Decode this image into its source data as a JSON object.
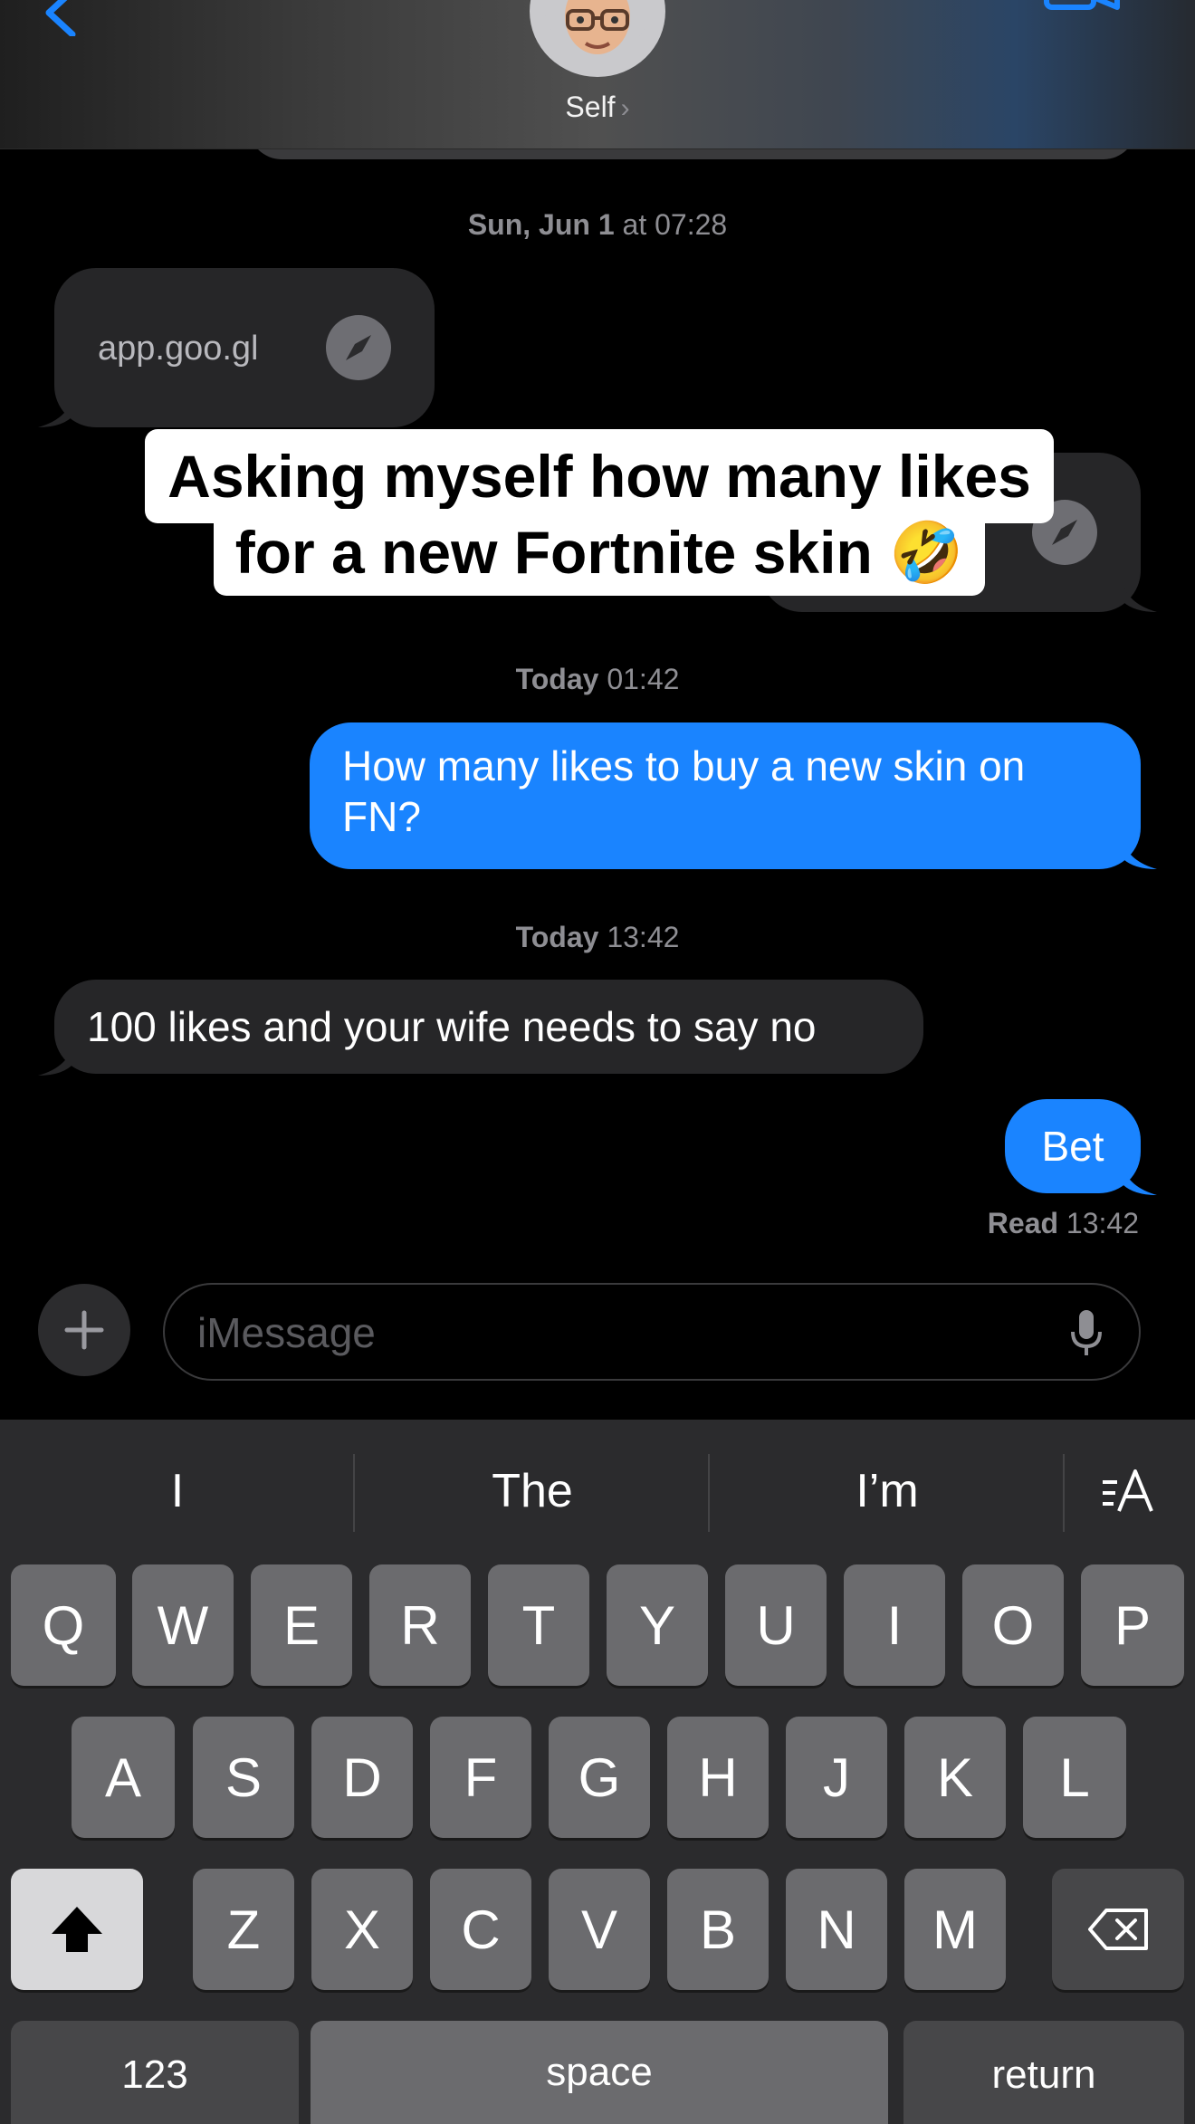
{
  "header": {
    "contact_name": "Self",
    "chevron": "›"
  },
  "messages": {
    "timestamp_1_day": "Sun, Jun 1",
    "timestamp_1_time": " at 07:28",
    "link_1_text": "app.goo.gl",
    "timestamp_2_day": "Today",
    "timestamp_2_time": " 01:42",
    "outgoing_1": "How many likes to buy a new skin on FN?",
    "timestamp_3_day": "Today",
    "timestamp_3_time": " 13:42",
    "incoming_1": "100 likes and your wife needs to say no",
    "outgoing_2": "Bet",
    "read_label": "Read",
    "read_time": " 13:42"
  },
  "caption": {
    "line_1": "Asking myself how many likes",
    "line_2": "for a new Fortnite skin 🤣"
  },
  "input": {
    "placeholder": "iMessage"
  },
  "keyboard": {
    "suggestions": [
      "I",
      "The",
      "I’m"
    ],
    "row1": [
      "Q",
      "W",
      "E",
      "R",
      "T",
      "Y",
      "U",
      "I",
      "O",
      "P"
    ],
    "row2": [
      "A",
      "S",
      "D",
      "F",
      "G",
      "H",
      "J",
      "K",
      "L"
    ],
    "row3": [
      "Z",
      "X",
      "C",
      "V",
      "B",
      "N",
      "M"
    ],
    "numbers_label": "123",
    "space_label": "space",
    "return_label": "return"
  },
  "icons": {
    "back": "chevron-left-icon",
    "video": "video-camera-icon",
    "compass": "safari-compass-icon",
    "plus": "plus-icon",
    "mic": "microphone-icon",
    "shift": "shift-arrow-icon",
    "delete": "delete-backspace-icon",
    "text_format": "text-format-icon"
  },
  "colors": {
    "accent": "#1a84ff",
    "incoming_bubble": "#262628",
    "background": "#000000",
    "keyboard": "#2b2b2d"
  }
}
